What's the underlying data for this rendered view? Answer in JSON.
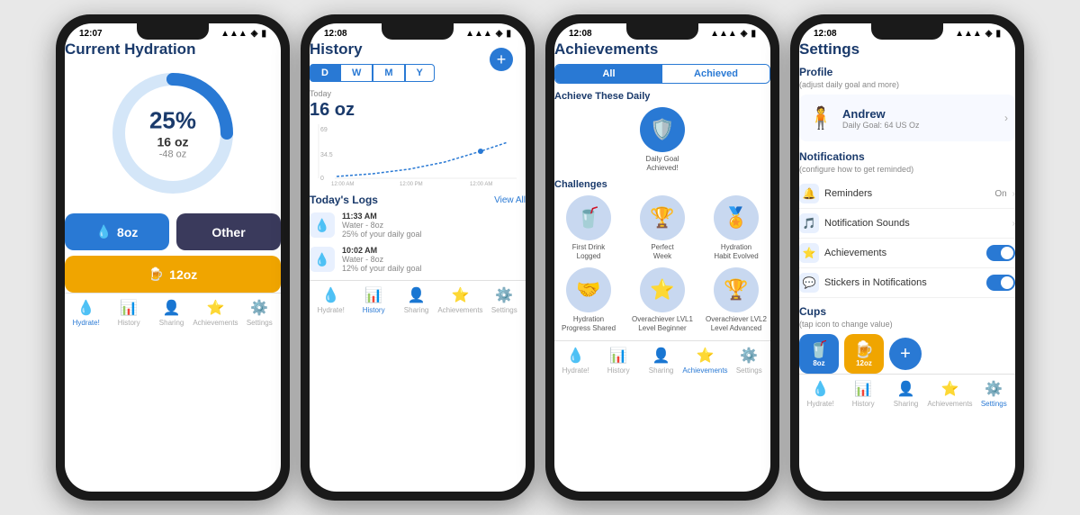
{
  "screen1": {
    "status_time": "12:07",
    "title": "Current Hydration",
    "percent": "25%",
    "oz": "16 oz",
    "deficit": "-48 oz",
    "ring_progress": 25,
    "btn_water": "8oz",
    "btn_other": "Other",
    "btn_beer": "12oz",
    "tabs": [
      {
        "label": "Hydrate!",
        "icon": "💧",
        "active": true
      },
      {
        "label": "History",
        "icon": "📊",
        "active": false
      },
      {
        "label": "Sharing",
        "icon": "👤",
        "active": false
      },
      {
        "label": "Achievements",
        "icon": "⭐",
        "active": false
      },
      {
        "label": "Settings",
        "icon": "⚙️",
        "active": false
      }
    ]
  },
  "screen2": {
    "status_time": "12:08",
    "title": "History",
    "period_tabs": [
      "D",
      "W",
      "M",
      "Y"
    ],
    "active_period": "D",
    "chart_label": "Today",
    "chart_value": "16 oz",
    "y_labels": [
      "69",
      "34.5",
      "0"
    ],
    "x_labels": [
      "12:00 AM",
      "12:00 PM",
      "12:00 AM"
    ],
    "logs_title": "Today's Logs",
    "view_all": "View All",
    "logs": [
      {
        "time": "11:33 AM",
        "drink": "Water - 8oz",
        "note": "25% of your daily goal"
      },
      {
        "time": "10:02 AM",
        "drink": "Water - 8oz",
        "note": "12% of your daily goal"
      }
    ],
    "tabs": [
      {
        "label": "Hydrate!",
        "icon": "💧",
        "active": false
      },
      {
        "label": "History",
        "icon": "📊",
        "active": true
      },
      {
        "label": "Sharing",
        "icon": "👤",
        "active": false
      },
      {
        "label": "Achievements",
        "icon": "⭐",
        "active": false
      },
      {
        "label": "Settings",
        "icon": "⚙️",
        "active": false
      }
    ]
  },
  "screen3": {
    "status_time": "12:08",
    "title": "Achievements",
    "ach_tabs": [
      "All",
      "Achieved"
    ],
    "active_ach_tab": "All",
    "section_daily": "Achieve These Daily",
    "section_challenges": "Challenges",
    "daily_badges": [
      {
        "name": "Daily Goal\nAchieved!",
        "icon": "🛡️",
        "highlight": true
      }
    ],
    "challenge_badges": [
      {
        "name": "First Drink\nLogged",
        "icon": "🥤"
      },
      {
        "name": "Perfect\nWeek",
        "icon": "🏆"
      },
      {
        "name": "Hydration\nHabit Evolved",
        "icon": "🏅"
      }
    ],
    "challenge_badges2": [
      {
        "name": "Hydration\nProgress Shared",
        "icon": "🤝"
      },
      {
        "name": "Overachiever LVL1\nLevel Beginner",
        "icon": "⭐"
      },
      {
        "name": "Overachiever LVL2\nLevel Advanced",
        "icon": "🏆"
      }
    ],
    "tabs": [
      {
        "label": "Hydrate!",
        "icon": "💧",
        "active": false
      },
      {
        "label": "History",
        "icon": "📊",
        "active": false
      },
      {
        "label": "Sharing",
        "icon": "👤",
        "active": false
      },
      {
        "label": "Achievements",
        "icon": "⭐",
        "active": true
      },
      {
        "label": "Settings",
        "icon": "⚙️",
        "active": false
      }
    ]
  },
  "screen4": {
    "status_time": "12:08",
    "title": "Settings",
    "profile_section": "Profile",
    "profile_subtitle": "(adjust daily goal and more)",
    "profile_name": "Andrew",
    "profile_goal": "Daily Goal: 64 US Oz",
    "notifications_section": "Notifications",
    "notifications_subtitle": "(configure how to get reminded)",
    "settings_rows": [
      {
        "icon": "🔔",
        "icon_bg": "#e8f0fe",
        "label": "Reminders",
        "value": "On",
        "type": "chevron"
      },
      {
        "icon": "🎵",
        "icon_bg": "#e8f0fe",
        "label": "Notification Sounds",
        "value": "",
        "type": "chevron"
      },
      {
        "icon": "⭐",
        "icon_bg": "#e8f0fe",
        "label": "Achievements",
        "value": "",
        "type": "toggle"
      },
      {
        "icon": "💬",
        "icon_bg": "#e8f0fe",
        "label": "Stickers in Notifications",
        "value": "",
        "type": "toggle"
      }
    ],
    "cups_section": "Cups",
    "cups_subtitle": "(tap icon to change value)",
    "cups": [
      {
        "icon": "🥤",
        "label": "8oz",
        "color": "blue"
      },
      {
        "icon": "🍺",
        "label": "12oz",
        "color": "gold"
      }
    ],
    "tabs": [
      {
        "label": "Hydrate!",
        "icon": "💧",
        "active": false
      },
      {
        "label": "History",
        "icon": "📊",
        "active": false
      },
      {
        "label": "Sharing",
        "icon": "👤",
        "active": false
      },
      {
        "label": "Achievements",
        "icon": "⭐",
        "active": false
      },
      {
        "label": "Settings",
        "icon": "⚙️",
        "active": true
      }
    ]
  }
}
